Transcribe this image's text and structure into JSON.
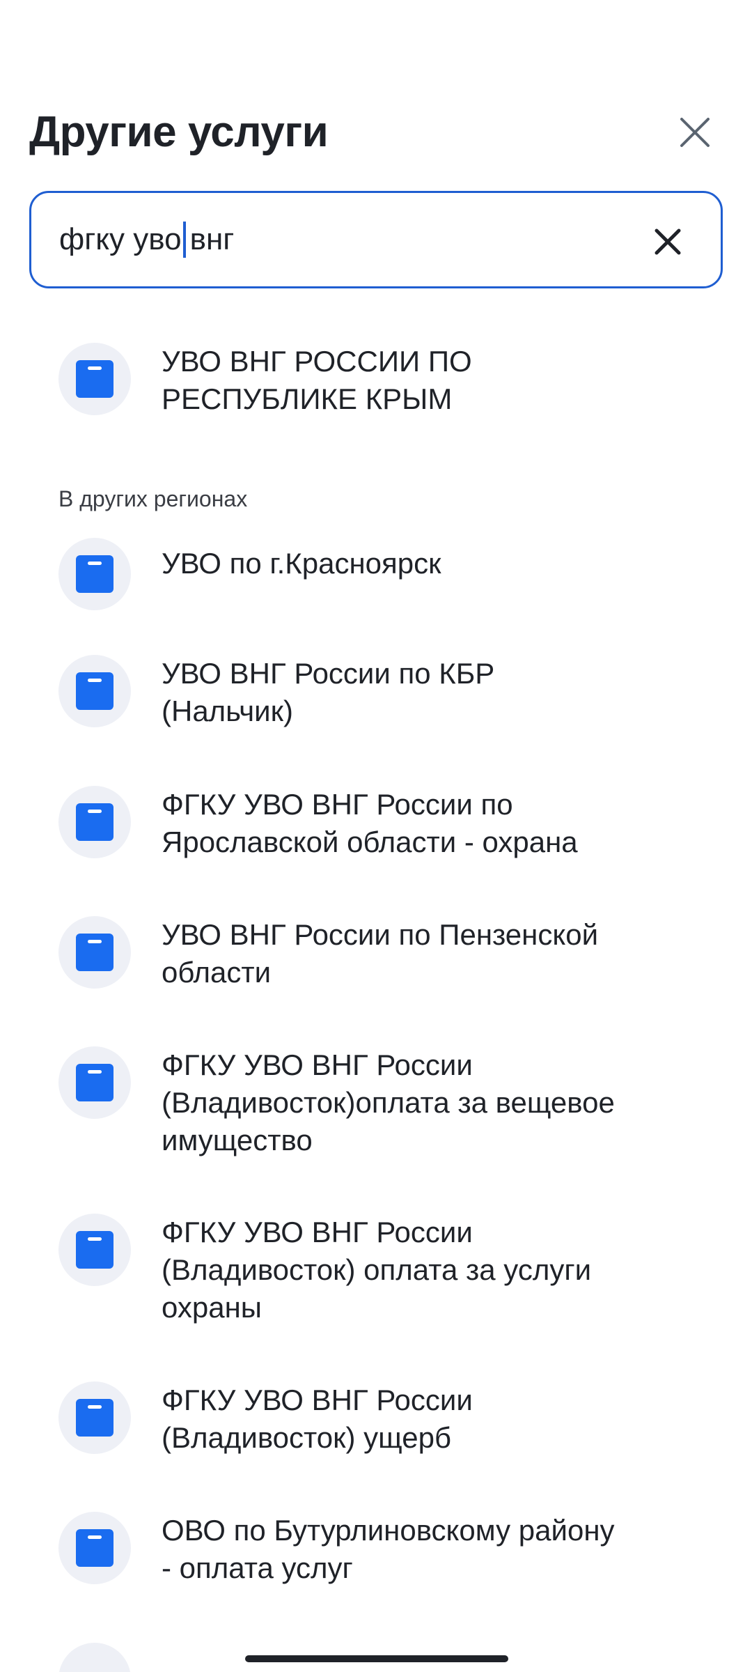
{
  "header": {
    "title": "Другие услуги",
    "close_icon": "close-icon"
  },
  "search": {
    "value_before_caret": "фгку уво",
    "value_after_caret": "внг",
    "clear_icon": "clear-icon"
  },
  "top_results": [
    {
      "label_lines": [
        "УВО ВНГ РОССИИ ПО",
        "РЕСПУБЛИКЕ КРЫМ"
      ],
      "icon": "document-icon"
    }
  ],
  "other_regions": {
    "section_label": "В других регионах",
    "items": [
      {
        "label_lines": [
          "УВО по г.Красноярск"
        ],
        "icon": "document-icon"
      },
      {
        "label_lines": [
          "УВО ВНГ России по КБР",
          "(Нальчик)"
        ],
        "icon": "document-icon"
      },
      {
        "label_lines": [
          "ФГКУ УВО ВНГ России по",
          "Ярославской области - охрана"
        ],
        "icon": "document-icon"
      },
      {
        "label_lines": [
          "УВО ВНГ России по Пензенской",
          "области"
        ],
        "icon": "document-icon"
      },
      {
        "label_lines": [
          "ФГКУ УВО ВНГ России",
          "(Владивосток)оплата за вещевое",
          "имущество"
        ],
        "icon": "document-icon"
      },
      {
        "label_lines": [
          "ФГКУ УВО ВНГ России",
          "(Владивосток) оплата за услуги",
          "охраны"
        ],
        "icon": "document-icon"
      },
      {
        "label_lines": [
          "ФГКУ УВО ВНГ России",
          "(Владивосток) ущерб"
        ],
        "icon": "document-icon"
      },
      {
        "label_lines": [
          "ОВО по Бутурлиновскому району",
          "- оплата услуг"
        ],
        "icon": "document-icon"
      }
    ]
  },
  "colors": {
    "accent": "#1f5ed1",
    "icon_blue": "#1a6cf0",
    "icon_bg": "#eef0f6",
    "text": "#1f2228"
  }
}
